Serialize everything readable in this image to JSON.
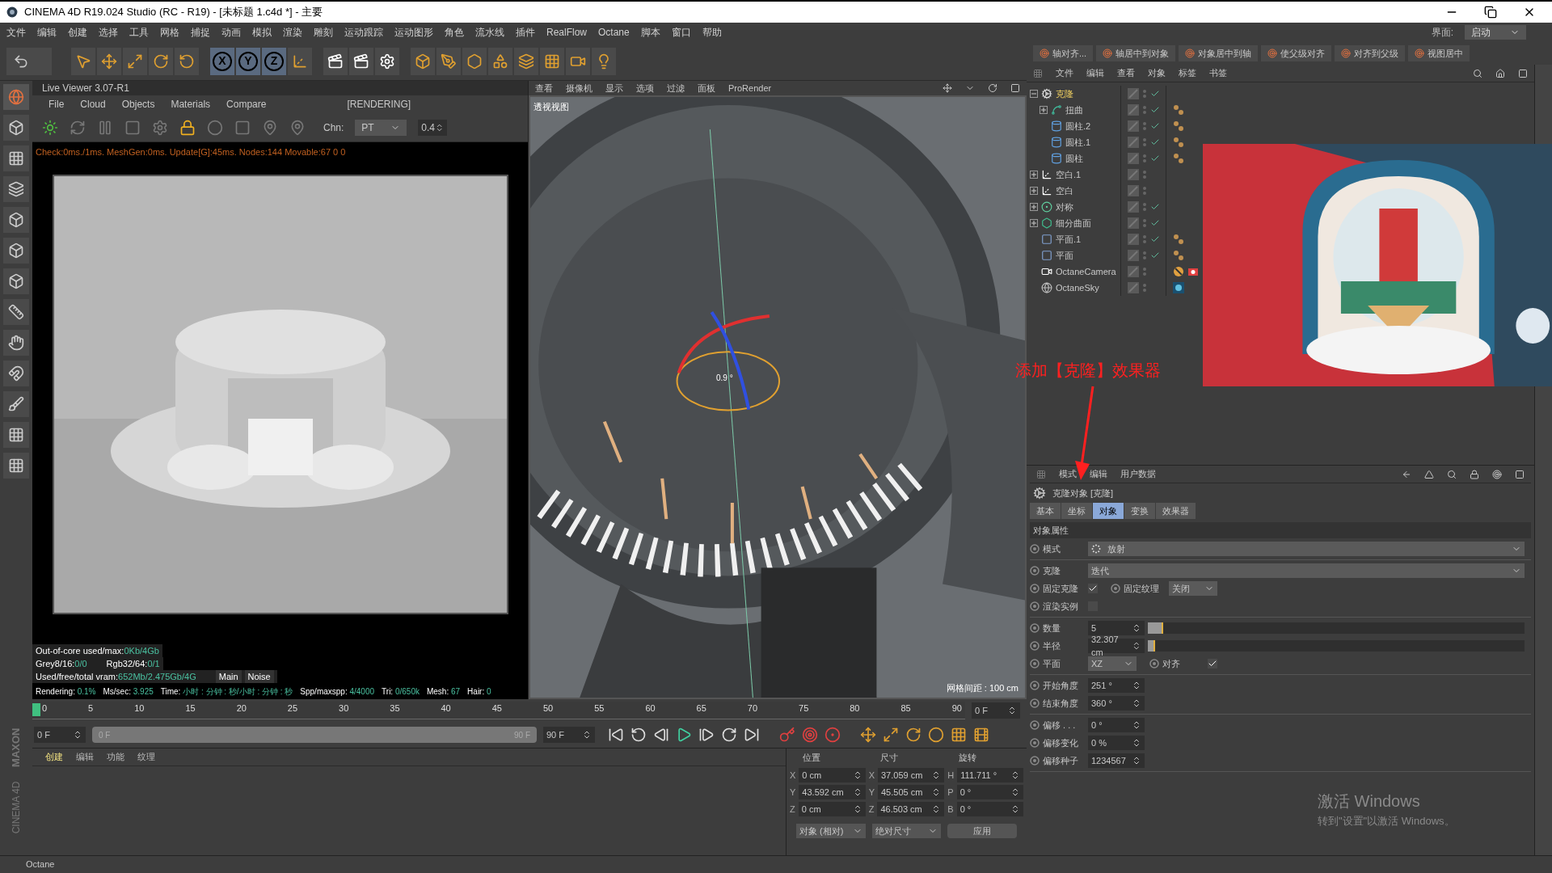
{
  "window": {
    "title": "CINEMA 4D R19.024 Studio (RC - R19) - [未标题 1.c4d *] - 主要"
  },
  "menu": [
    "文件",
    "编辑",
    "创建",
    "选择",
    "工具",
    "网格",
    "捕捉",
    "动画",
    "模拟",
    "渲染",
    "雕刻",
    "运动跟踪",
    "运动图形",
    "角色",
    "流水线",
    "插件",
    "RealFlow",
    "Octane",
    "脚本",
    "窗口",
    "帮助"
  ],
  "layout_switch": {
    "label": "界面:",
    "value": "启动"
  },
  "axis_buttons": [
    "X",
    "Y",
    "Z"
  ],
  "live_viewer": {
    "title": "Live Viewer 3.07-R1",
    "menu": [
      "File",
      "Cloud",
      "Objects",
      "Materials",
      "Compare"
    ],
    "status": "[RENDERING]",
    "channel_label": "Chn:",
    "channel": "PT",
    "channel_value": "0.4",
    "log": "Check:0ms./1ms. MeshGen:0ms. Update[G]:45ms. Nodes:144 Movable:67  0 0",
    "memory": [
      [
        {
          "label": "Out-of-core used/max:",
          "value": "0Kb/4Gb"
        }
      ],
      [
        {
          "label": "Grey8/16:",
          "value": "0/0"
        },
        {
          "label": "Rgb32/64:",
          "value": "0/1"
        }
      ],
      [
        {
          "label": "Used/free/total vram:",
          "value": "652Mb/2.475Gb/4G"
        }
      ]
    ],
    "view_tabs": [
      "Main",
      "Noise"
    ],
    "stats": [
      {
        "label": "Rendering:",
        "value": "0.1%"
      },
      {
        "label": "Ms/sec:",
        "value": "3.925"
      },
      {
        "label": "Time:",
        "value": "小时 : 分钟 : 秒/小时 : 分钟 : 秒"
      },
      {
        "label": "Spp/maxspp:",
        "value": "4/4000"
      },
      {
        "label": "Tri:",
        "value": "0/650k"
      },
      {
        "label": "Mesh:",
        "value": "67"
      },
      {
        "label": "Hair:",
        "value": "0"
      }
    ]
  },
  "viewport": {
    "menu": [
      "查看",
      "摄像机",
      "显示",
      "选项",
      "过滤",
      "面板",
      "ProRender"
    ],
    "label": "透视视图",
    "angle": "0.9 °",
    "grid": "网格间距 : 100 cm"
  },
  "timeline": {
    "ticks": [
      "0",
      "5",
      "10",
      "15",
      "20",
      "25",
      "30",
      "35",
      "40",
      "45",
      "50",
      "55",
      "60",
      "65",
      "70",
      "75",
      "80",
      "85",
      "90"
    ],
    "level": 0,
    "current": "0 F",
    "start": "0 F",
    "range": {
      "start": "0 F",
      "end": "90 F",
      "level": 1
    },
    "end": "90 F"
  },
  "material_manager": {
    "tabs": [
      {
        "label": "创建",
        "selected": true
      },
      {
        "label": "编辑",
        "selected": false
      },
      {
        "label": "功能",
        "selected": false
      },
      {
        "label": "纹理",
        "selected": false
      }
    ]
  },
  "coordinates": {
    "headers": [
      "位置",
      "尺寸",
      "旋转"
    ],
    "rows": [
      [
        {
          "axis": "X",
          "value": "0 cm"
        },
        {
          "axis": "X",
          "value": "37.059 cm"
        },
        {
          "axis": "H",
          "value": "111.711 °"
        }
      ],
      [
        {
          "axis": "Y",
          "value": "43.592 cm"
        },
        {
          "axis": "Y",
          "value": "45.505 cm"
        },
        {
          "axis": "P",
          "value": "0 °"
        }
      ],
      [
        {
          "axis": "Z",
          "value": "0 cm"
        },
        {
          "axis": "Z",
          "value": "46.503 cm"
        },
        {
          "axis": "B",
          "value": "0 °"
        }
      ]
    ],
    "modes": [
      "对象 (相对)",
      "绝对尺寸"
    ],
    "apply": "应用"
  },
  "brand": [
    "MAXON",
    "CINEMA 4D"
  ],
  "status_bar": "Octane",
  "align_toolbar": [
    "轴对齐...",
    "轴居中到对象",
    "对象居中到轴",
    "使父级对齐",
    "对齐到父级",
    "视图居中"
  ],
  "object_manager": {
    "menu": [
      "文件",
      "编辑",
      "查看",
      "对象",
      "标签",
      "书签"
    ],
    "tree": [
      {
        "name": "克隆",
        "kind": "cloner",
        "expanded": true,
        "selected": true,
        "enabled": true,
        "children": [
          {
            "name": "扭曲",
            "kind": "spline",
            "expanded": false,
            "selected": false,
            "enabled": true,
            "tags": [
              {
                "kind": "material"
              }
            ]
          },
          {
            "name": "圆柱.2",
            "kind": "cylinder",
            "selected": false,
            "enabled": true,
            "tags": [
              {
                "kind": "material"
              }
            ]
          },
          {
            "name": "圆柱.1",
            "kind": "cylinder",
            "selected": false,
            "enabled": true,
            "tags": [
              {
                "kind": "material"
              }
            ]
          },
          {
            "name": "圆柱",
            "kind": "cylinder",
            "selected": false,
            "enabled": true,
            "tags": [
              {
                "kind": "material"
              }
            ]
          }
        ]
      },
      {
        "name": "空白.1",
        "kind": "null",
        "expanded": false,
        "selected": false,
        "enabled": false
      },
      {
        "name": "空白",
        "kind": "null",
        "expanded": false,
        "selected": false,
        "enabled": false
      },
      {
        "name": "对称",
        "kind": "symmetry",
        "expanded": false,
        "selected": false,
        "enabled": true
      },
      {
        "name": "细分曲面",
        "kind": "subdivision",
        "expanded": false,
        "selected": false,
        "enabled": true
      },
      {
        "name": "平面.1",
        "kind": "plane",
        "selected": false,
        "enabled": true,
        "tags": [
          {
            "kind": "material"
          }
        ]
      },
      {
        "name": "平面",
        "kind": "plane",
        "selected": false,
        "enabled": true,
        "tags": [
          {
            "kind": "material"
          }
        ]
      },
      {
        "name": "OctaneCamera",
        "kind": "camera",
        "selected": false,
        "enabled": false,
        "tags": [
          {
            "kind": "prohibited"
          },
          {
            "kind": "camera"
          }
        ]
      },
      {
        "name": "OctaneSky",
        "kind": "sky",
        "selected": false,
        "enabled": false,
        "tags": [
          {
            "kind": "sky"
          }
        ]
      }
    ]
  },
  "annotation": {
    "text": "添加【克隆】效果器"
  },
  "attributes": {
    "menu": [
      "模式",
      "编辑",
      "用户数据"
    ],
    "object_title": "克隆对象 [克隆]",
    "tabs": [
      {
        "label": "基本",
        "selected": false
      },
      {
        "label": "坐标",
        "selected": false
      },
      {
        "label": "对象",
        "selected": true
      },
      {
        "label": "变换",
        "selected": false
      },
      {
        "label": "效果器",
        "selected": false
      }
    ],
    "section": "对象属性",
    "groups": [
      [
        {
          "kind": "dropdown",
          "label": "模式",
          "value": "放射"
        }
      ],
      [
        {
          "kind": "dropdown",
          "label": "克隆",
          "value": "迭代"
        },
        {
          "kind": "pair",
          "items": [
            {
              "kind": "checkbox",
              "label": "固定克隆",
              "checked": true
            },
            {
              "kind": "select",
              "label": "固定纹理",
              "value": "关闭"
            }
          ]
        },
        {
          "kind": "checkbox",
          "label": "渲染实例",
          "checked": false
        }
      ],
      [
        {
          "kind": "slider",
          "label": "数量",
          "value": "5",
          "level": 0.04
        },
        {
          "kind": "slider",
          "label": "半径",
          "value": "32.307 cm",
          "level": 0.02
        },
        {
          "kind": "pair",
          "items": [
            {
              "kind": "select",
              "label": "平面",
              "value": "XZ"
            },
            {
              "kind": "checkbox",
              "label": "对齐",
              "checked": true
            }
          ]
        }
      ],
      [
        {
          "kind": "number",
          "label": "开始角度",
          "value": "251 °"
        },
        {
          "kind": "number",
          "label": "结束角度",
          "value": "360 °"
        }
      ],
      [
        {
          "kind": "number",
          "label": "偏移 . . .",
          "value": "0 °"
        },
        {
          "kind": "number",
          "label": "偏移变化",
          "value": "0 %"
        },
        {
          "kind": "number",
          "label": "偏移种子",
          "value": "1234567"
        }
      ]
    ]
  },
  "windows_notice": {
    "title": "激活 Windows",
    "text": "转到\"设置\"以激活 Windows。"
  }
}
